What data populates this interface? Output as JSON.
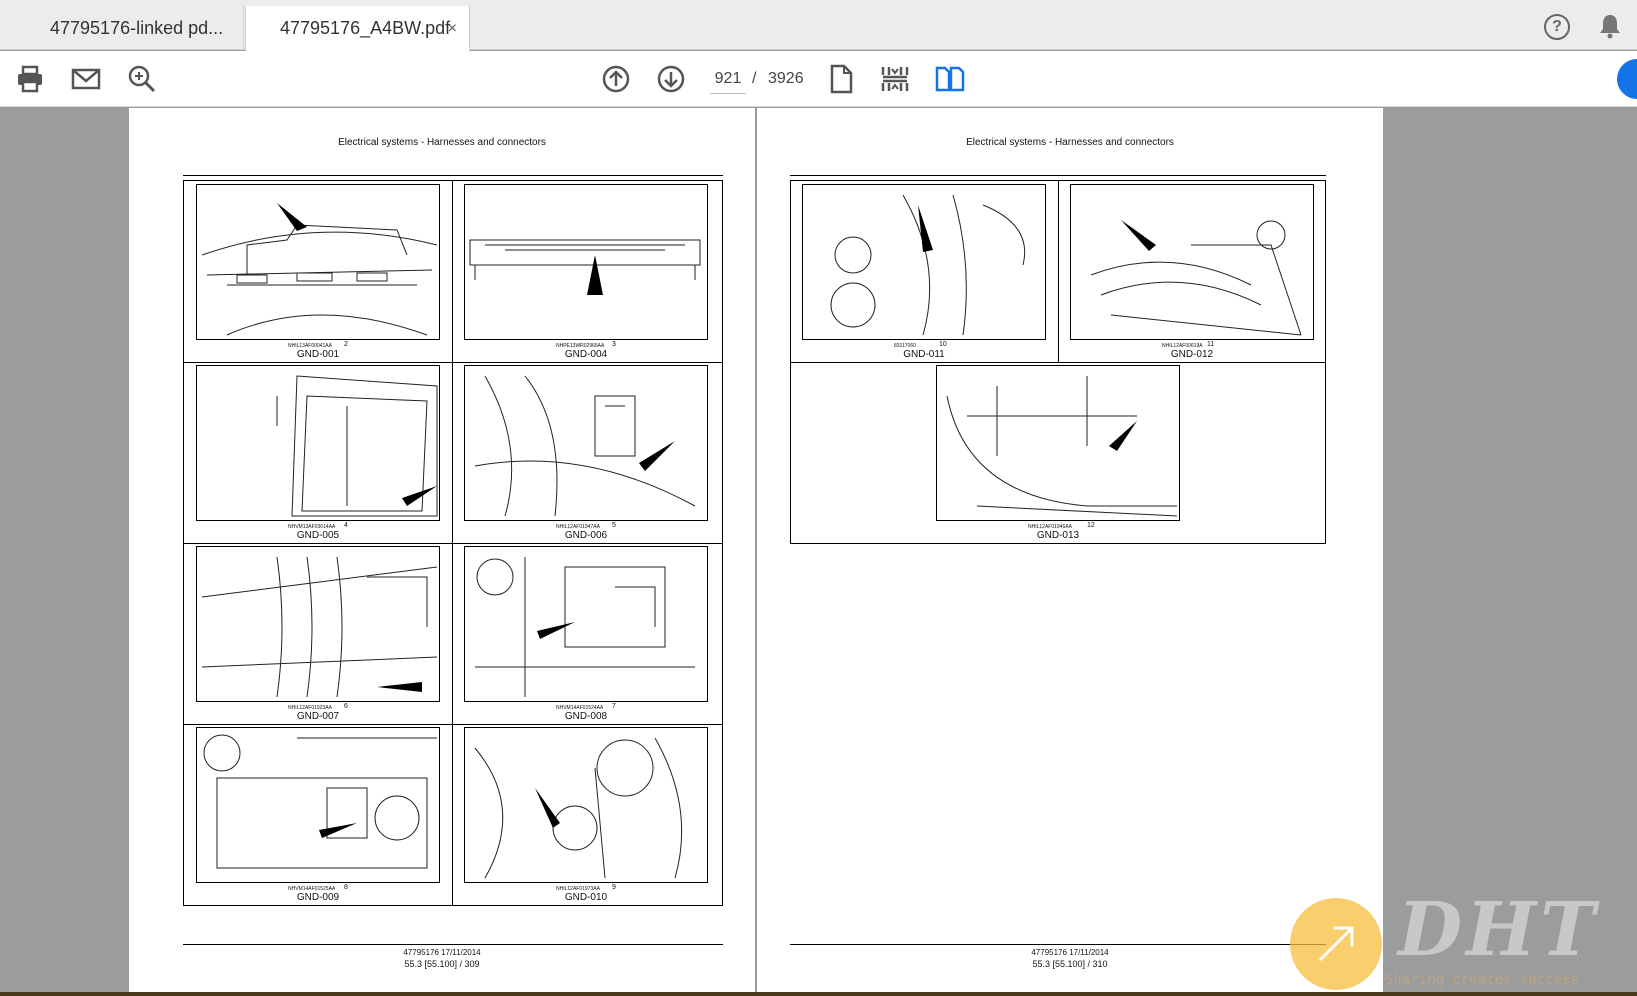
{
  "tabs": [
    {
      "label": "47795176-linked pd...",
      "active": false
    },
    {
      "label": "47795176_A4BW.pdf",
      "active": true,
      "close": "×"
    }
  ],
  "help": "?",
  "toolbar": {
    "current_page": "921",
    "separator": "/",
    "total_pages": "3926",
    "icons": [
      "print-icon",
      "email-icon",
      "zoom-search-icon",
      "page-up-icon",
      "page-down-icon",
      "single-page-icon",
      "fit-page-icon",
      "two-page-icon"
    ]
  },
  "left_page": {
    "header": "Electrical systems - Harnesses and connectors",
    "figures": [
      {
        "id": "NHIL13AF00041AA",
        "num": "2",
        "label": "GND-001"
      },
      {
        "id": "NHPE13WR02966AA",
        "num": "3",
        "label": "GND-004"
      },
      {
        "id": "NHVM13AF03614AA",
        "num": "4",
        "label": "GND-005"
      },
      {
        "id": "NHIL12AF01947AA",
        "num": "5",
        "label": "GND-006"
      },
      {
        "id": "NHIL12AF01923AA",
        "num": "6",
        "label": "GND-007"
      },
      {
        "id": "NHVM14AF01524AA",
        "num": "7",
        "label": "GND-008"
      },
      {
        "id": "NHVM14AF01525AA",
        "num": "8",
        "label": "GND-009"
      },
      {
        "id": "NHIL12AF01973AA",
        "num": "9",
        "label": "GND-010"
      }
    ],
    "footer_doc": "47795176 17/11/2014",
    "footer_page": "55.3 [55.100] / 309"
  },
  "right_page": {
    "header": "Electrical systems - Harnesses and connectors",
    "figures": [
      {
        "id": "83117060",
        "num": "10",
        "label": "GND-011"
      },
      {
        "id": "NHIL12AF00619A",
        "num": "11",
        "label": "GND-012"
      },
      {
        "id": "NHIL12AF01946AA",
        "num": "12",
        "label": "GND-013"
      }
    ],
    "footer_doc": "47795176 17/11/2014",
    "footer_page": "55.3 [55.100] / 310"
  },
  "watermark": {
    "brand": "DHT",
    "slogan": "Sharing creates success"
  }
}
